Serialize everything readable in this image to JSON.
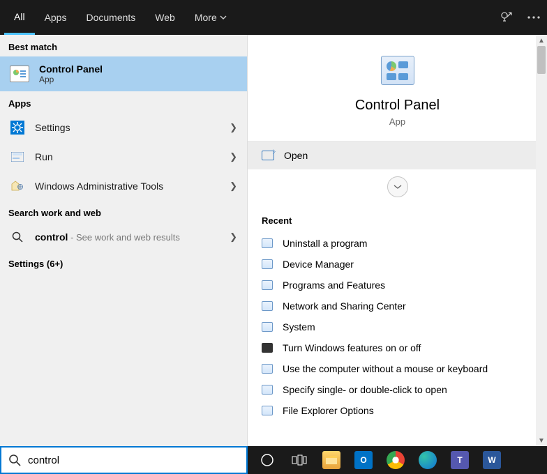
{
  "tabs": {
    "all": "All",
    "apps": "Apps",
    "documents": "Documents",
    "web": "Web",
    "more": "More"
  },
  "sections": {
    "bestMatch": "Best match",
    "apps": "Apps",
    "searchWeb": "Search work and web",
    "settingsMore": "Settings (6+)"
  },
  "bestMatch": {
    "title": "Control Panel",
    "sub": "App"
  },
  "apps": {
    "0": {
      "label": "Settings"
    },
    "1": {
      "label": "Run"
    },
    "2": {
      "label": "Windows Administrative Tools"
    }
  },
  "web": {
    "term": "control",
    "sub": " - See work and web results"
  },
  "detail": {
    "title": "Control Panel",
    "sub": "App",
    "open": "Open"
  },
  "recent": {
    "title": "Recent",
    "0": "Uninstall a program",
    "1": "Device Manager",
    "2": "Programs and Features",
    "3": "Network and Sharing Center",
    "4": "System",
    "5": "Turn Windows features on or off",
    "6": "Use the computer without a mouse or keyboard",
    "7": "Specify single- or double-click to open",
    "8": "File Explorer Options"
  },
  "search": {
    "value": "control"
  }
}
